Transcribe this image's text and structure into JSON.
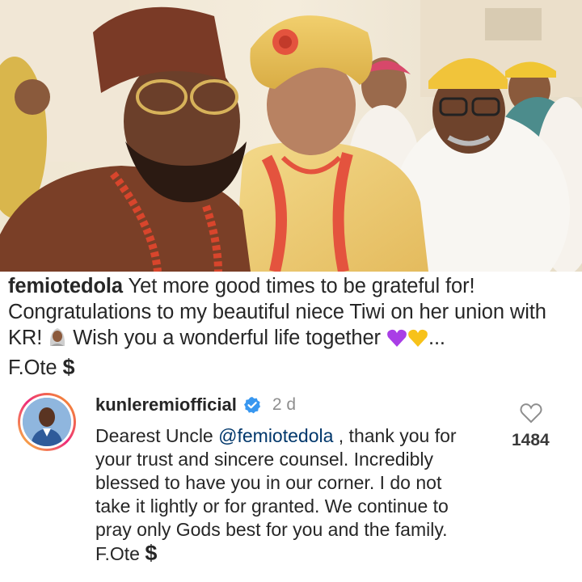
{
  "post": {
    "username": "femiotedola",
    "caption_1": "Yet more good times to be grateful for! Congratulations to my beautiful niece Tiwi on her union with KR!",
    "caption_2": "Wish you a wonderful life together",
    "caption_3": "...",
    "signature": "F.Ote",
    "signature_symbol": "$",
    "emojis": [
      "bride-with-veil-emoji",
      "purple-heart-emoji",
      "yellow-heart-emoji"
    ]
  },
  "comment": {
    "username": "kunleremiofficial",
    "verified": true,
    "time": "2 d",
    "text_before": "Dearest Uncle ",
    "mention": "@femiotedola",
    "text_after": " , thank you for your trust and sincere counsel. Incredibly blessed to have you in our corner. I do not take it lightly or for granted. We continue to pray only Gods best for you and the family. F.Ote ",
    "signature_symbol": "$",
    "like_count": "1484"
  },
  "colors": {
    "mention": "#00376b",
    "verified_badge": "#3897f0",
    "purple_heart": "#a93ee6",
    "yellow_heart": "#f7c21a",
    "avatar_ring_start": "#f9ce34",
    "avatar_ring_end": "#ee2a7b"
  },
  "icons": {
    "like": "heart-outline-icon",
    "verified": "verified-badge-icon"
  }
}
